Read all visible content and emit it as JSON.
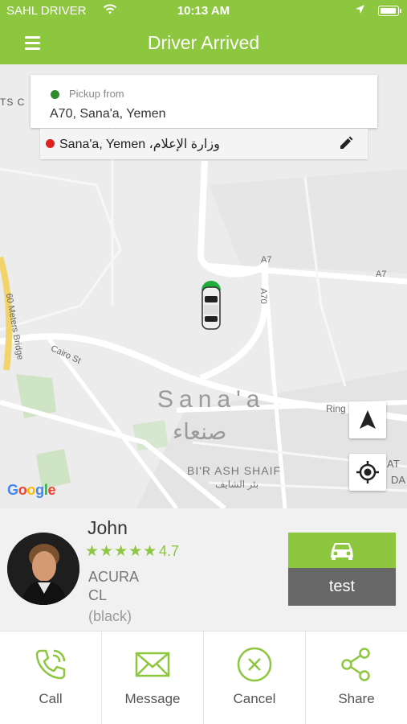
{
  "status_bar": {
    "carrier": "SAHL DRIVER",
    "time": "10:13 AM"
  },
  "nav": {
    "title": "Driver Arrived",
    "menu_icon": "hamburger-icon"
  },
  "map": {
    "labels": {
      "a7_1": "A7",
      "a7_2": "A7",
      "a70": "A70",
      "meters_bridge": "60 Meters Bridge",
      "cairo_st": "Cairo St",
      "city_en": "Sana'a",
      "city_ar": "صنعاء",
      "ring": "Ring",
      "bir_ash_shaif": "BI'R ASH SHAIF",
      "bir_ash_shaif_ar": "بئر الشايف",
      "edge_ts": "TS C",
      "edge_at": "AT",
      "edge_da": "DA"
    },
    "google": "Google"
  },
  "pickup": {
    "hint": "Pickup from",
    "address": "A70,  Sana'a,  Yemen"
  },
  "dropoff": {
    "address": "Sana'a,  Yemen ،وزارة الإعلام"
  },
  "driver": {
    "name": "John",
    "rating_value": 4.7,
    "rating_text": "4.7",
    "car_make": "ACURA",
    "car_model": "CL",
    "car_color": "(black)",
    "car_type_label": "test"
  },
  "actions": [
    {
      "label": "Call",
      "icon": "phone-icon"
    },
    {
      "label": "Message",
      "icon": "envelope-icon"
    },
    {
      "label": "Cancel",
      "icon": "cancel-icon"
    },
    {
      "label": "Share",
      "icon": "share-icon"
    }
  ],
  "colors": {
    "brand_green": "#8dc63f",
    "pickup_dot": "#2e8b2e",
    "dropoff_dot": "#e02020",
    "car_type_gray": "#676767"
  }
}
